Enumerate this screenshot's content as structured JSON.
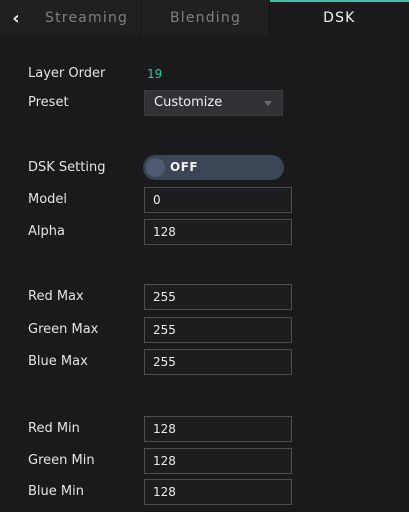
{
  "tabs": {
    "back_glyph": "‹",
    "items": [
      "Streaming",
      "Blending",
      "DSK"
    ],
    "active": "DSK"
  },
  "layer_order": {
    "label": "Layer Order",
    "value": "19"
  },
  "preset": {
    "label": "Preset",
    "value": "Customize"
  },
  "dsk_setting": {
    "label": "DSK Setting",
    "value": "OFF"
  },
  "model": {
    "label": "Model",
    "value": "0"
  },
  "alpha": {
    "label": "Alpha",
    "value": "128"
  },
  "red_max": {
    "label": "Red Max",
    "value": "255"
  },
  "green_max": {
    "label": "Green Max",
    "value": "255"
  },
  "blue_max": {
    "label": "Blue Max",
    "value": "255"
  },
  "red_min": {
    "label": "Red Min",
    "value": "128"
  },
  "green_min": {
    "label": "Green Min",
    "value": "128"
  },
  "blue_min": {
    "label": "Blue Min",
    "value": "128"
  },
  "colors": {
    "accent": "#37c6a4",
    "toggle_off": "#3b4556"
  }
}
